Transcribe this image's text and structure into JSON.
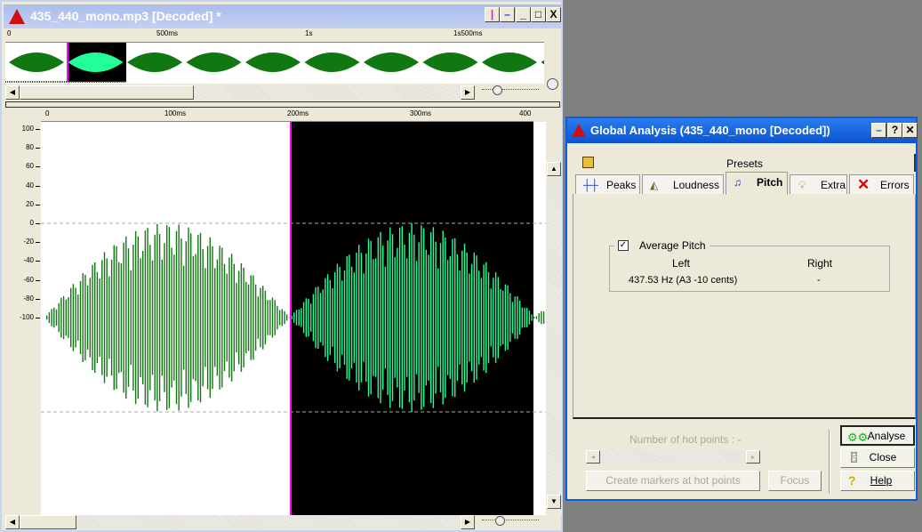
{
  "editor": {
    "title": "435_440_mono.mp3 [Decoded] *",
    "overview_ruler": [
      "0",
      "500ms",
      "1s",
      "1s500ms"
    ],
    "main_ruler": [
      "0",
      "100ms",
      "200ms",
      "300ms",
      "400"
    ],
    "y_axis": [
      "100",
      "80",
      "60",
      "40",
      "20",
      "0",
      "-20",
      "-40",
      "-60",
      "-80",
      "-100"
    ],
    "colors": {
      "wave": "#117711",
      "wave_selected": "#22ff99",
      "cursor": "#ff00ff",
      "selection_bg": "#000000"
    },
    "buttons": {
      "minimize": "_",
      "maximize": "□",
      "close": "X"
    }
  },
  "dialog": {
    "title": "Global Analysis (435_440_mono [Decoded])",
    "presets_tab": "Presets",
    "tabs": [
      "Peaks",
      "Loudness",
      "Pitch",
      "Extra",
      "Errors"
    ],
    "active_tab": "Pitch",
    "group": {
      "label": "Average Pitch",
      "checked": true,
      "col_left": "Left",
      "col_right": "Right",
      "left_value": "437.53 Hz (A3 -10 cents)",
      "right_value": "-"
    },
    "hot_points_label": "Number of hot points :  -",
    "create_markers": "Create markers at hot points",
    "focus": "Focus",
    "analyse": "Analyse",
    "close": "Close",
    "help": "Help",
    "title_buttons": {
      "minimize": "–",
      "help": "?",
      "close": "✕"
    }
  }
}
